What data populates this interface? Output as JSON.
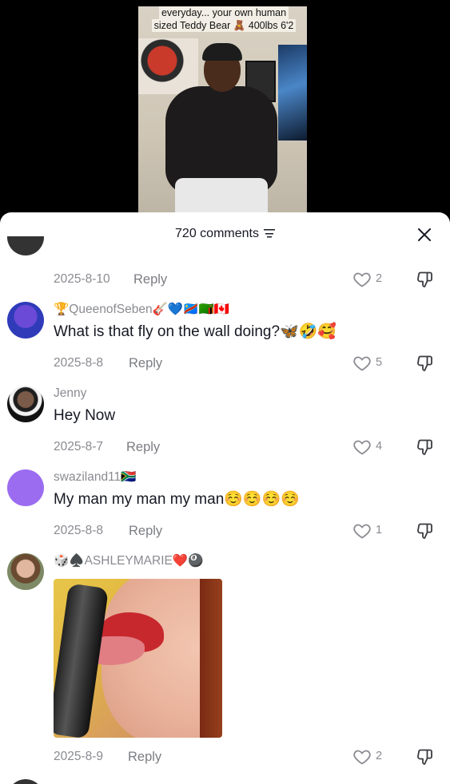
{
  "video": {
    "caption_line1": "everyday... your own human",
    "caption_line2": "sized Teddy Bear 🧸 400lbs 6'2"
  },
  "sheet": {
    "title": "720 comments",
    "close_label": "✕"
  },
  "top_comment": {
    "date": "2025-8-10",
    "reply": "Reply",
    "likes": "2"
  },
  "comments": [
    {
      "username": "🏆QueenofSeben🎸💙🇨🇩🇿🇲🇨🇦",
      "text": "What is that fly on the wall doing?🦋🤣🥰",
      "date": "2025-8-8",
      "reply": "Reply",
      "likes": "5",
      "avatar_color": "#2f3bb8"
    },
    {
      "username": "Jenny",
      "text": "Hey Now",
      "date": "2025-8-7",
      "reply": "Reply",
      "likes": "4",
      "avatar_color": "#3a3a3a"
    },
    {
      "username": "swaziland11🇿🇦",
      "text": "My man my man my man☺️☺️☺️☺️",
      "date": "2025-8-8",
      "reply": "Reply",
      "likes": "1",
      "avatar_color": "#9b6cf0"
    },
    {
      "username": "🎲♠️ASHLEYMARIE❤️🎱",
      "text": "",
      "date": "2025-8-9",
      "reply": "Reply",
      "likes": "2",
      "avatar_color": "#6a7a55"
    }
  ],
  "colors": {
    "text_primary": "#161823",
    "text_secondary": "#8a8b91",
    "sheet_bg": "#ffffff"
  }
}
